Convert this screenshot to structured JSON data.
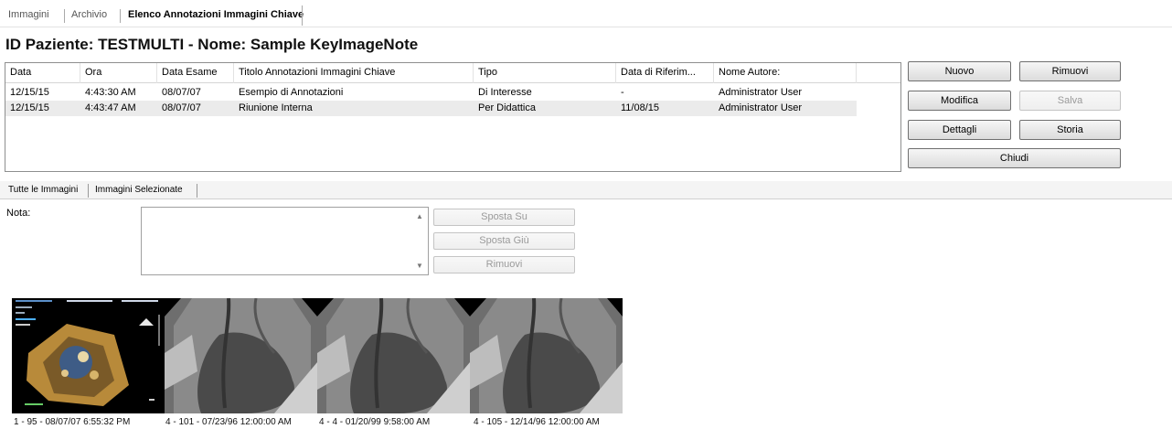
{
  "top_tabs": [
    {
      "label": "Immagini"
    },
    {
      "label": "Archivio"
    },
    {
      "label": "Elenco Annotazioni Immagini Chiave"
    }
  ],
  "title": "ID Paziente: TESTMULTI - Nome: Sample KeyImageNote",
  "grid": {
    "columns": [
      "Data",
      "Ora",
      "Data Esame",
      "Titolo Annotazioni Immagini Chiave",
      "Tipo",
      "Data di Riferim...",
      "Nome Autore:"
    ],
    "rows": [
      [
        "12/15/15",
        "4:43:30 AM",
        "08/07/07",
        "Esempio di Annotazioni",
        "Di Interesse",
        "-",
        "Administrator User"
      ],
      [
        "12/15/15",
        "4:43:47 AM",
        "08/07/07",
        "Riunione Interna",
        "Per Didattica",
        "11/08/15",
        "Administrator User"
      ]
    ]
  },
  "buttons": {
    "nuovo": "Nuovo",
    "rimuovi": "Rimuovi",
    "modifica": "Modifica",
    "salva": "Salva",
    "dettagli": "Dettagli",
    "storia": "Storia",
    "chiudi": "Chiudi"
  },
  "lower_tabs": [
    "Tutte le Immagini",
    "Immagini Selezionate"
  ],
  "nota": {
    "label": "Nota:",
    "value": ""
  },
  "note_buttons": {
    "sposta_su": "Sposta Su",
    "sposta_giu": "Sposta Giù",
    "rimuovi": "Rimuovi"
  },
  "thumbnails": [
    {
      "caption": "1 - 95 - 08/07/07 6:55:32 PM"
    },
    {
      "caption": "4 - 101 - 07/23/96 12:00:00 AM"
    },
    {
      "caption": "4 - 4 - 01/20/99 9:58:00 AM"
    },
    {
      "caption": "4 - 105 - 12/14/96 12:00:00 AM"
    }
  ]
}
